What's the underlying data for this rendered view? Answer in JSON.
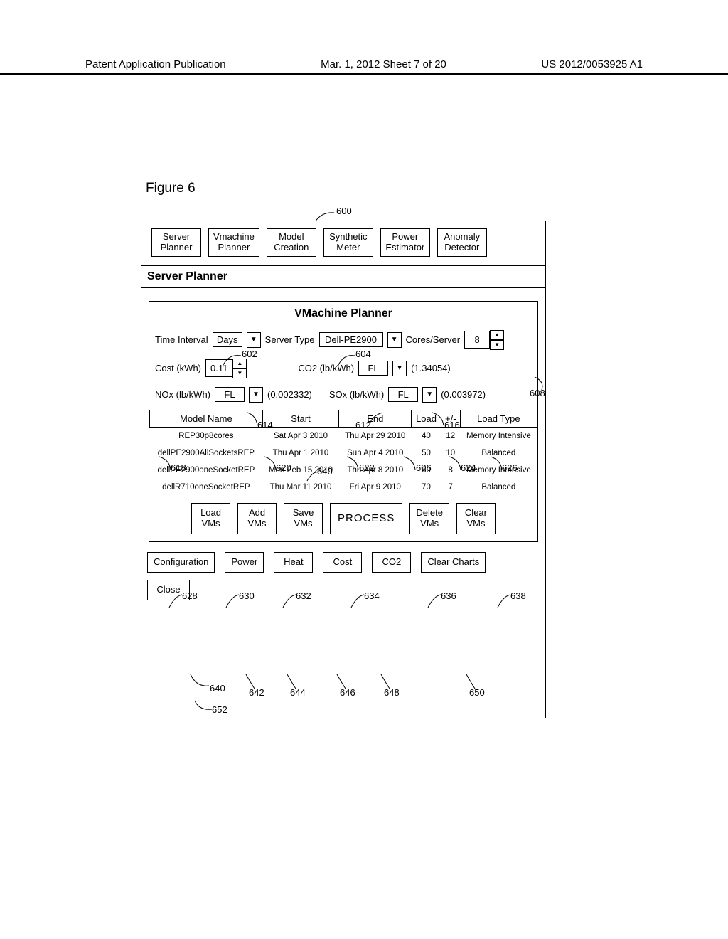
{
  "header": {
    "left": "Patent Application Publication",
    "center": "Mar. 1, 2012  Sheet 7 of 20",
    "right": "US 2012/0053925 A1"
  },
  "figure_label": "Figure 6",
  "panel_ref": "600",
  "tabs": [
    {
      "l1": "Server",
      "l2": "Planner"
    },
    {
      "l1": "Vmachine",
      "l2": "Planner"
    },
    {
      "l1": "Model",
      "l2": "Creation"
    },
    {
      "l1": "Synthetic",
      "l2": "Meter"
    },
    {
      "l1": "Power",
      "l2": "Estimator"
    },
    {
      "l1": "Anomaly",
      "l2": "Detector"
    }
  ],
  "section_title": "Server Planner",
  "inner_title": "VMachine Planner",
  "row1": {
    "time_interval_label": "Time Interval",
    "time_interval_value": "Days",
    "server_type_label": "Server Type",
    "server_type_value": "Dell-PE2900",
    "cores_label": "Cores/Server",
    "cores_value": "8"
  },
  "row2": {
    "cost_label": "Cost (kWh)",
    "cost_value": "0.11",
    "co2_label": "CO2 (lb/kWh)",
    "co2_sel": "FL",
    "co2_paren": "(1.34054)"
  },
  "row3": {
    "nox_label": "NOx (lb/kWh)",
    "nox_sel": "FL",
    "nox_paren": "(0.002332)",
    "sox_label": "SOx (lb/kWh)",
    "sox_sel": "FL",
    "sox_paren": "(0.003972)"
  },
  "table": {
    "headers": [
      "Model Name",
      "Start",
      "End",
      "Load",
      "+/-",
      "Load Type"
    ],
    "rows": [
      [
        "REP30p8cores",
        "Sat Apr 3 2010",
        "Thu Apr 29 2010",
        "40",
        "12",
        "Memory Intensive"
      ],
      [
        "dellPE2900AllSocketsREP",
        "Thu Apr 1 2010",
        "Sun Apr 4 2010",
        "50",
        "10",
        "Balanced"
      ],
      [
        "dellPE2900oneSocketREP",
        "Mon Feb 15 2010",
        "Thu Apr 8 2010",
        "60",
        "8",
        "Memory Intensive"
      ],
      [
        "dellR710oneSocketREP",
        "Thu Mar 11 2010",
        "Fri Apr 9 2010",
        "70",
        "7",
        "Balanced"
      ]
    ]
  },
  "vm_buttons": [
    {
      "l1": "Load",
      "l2": "VMs"
    },
    {
      "l1": "Add",
      "l2": "VMs"
    },
    {
      "l1": "Save",
      "l2": "VMs"
    },
    {
      "l1": "PROCESS",
      "l2": ""
    },
    {
      "l1": "Delete",
      "l2": "VMs"
    },
    {
      "l1": "Clear",
      "l2": "VMs"
    }
  ],
  "chart_buttons": [
    "Configuration",
    "Power",
    "Heat",
    "Cost",
    "CO2",
    "Clear Charts"
  ],
  "close_label": "Close",
  "callouts": {
    "c600": "600",
    "c602": "602",
    "c604": "604",
    "c608": "608",
    "c614": "614",
    "c612": "612",
    "c616": "616",
    "c618": "618",
    "c620": "620",
    "c640a": "640",
    "c622": "622",
    "c606": "606",
    "c624": "624",
    "c626": "626",
    "c628": "628",
    "c630": "630",
    "c632": "632",
    "c634": "634",
    "c636": "636",
    "c638": "638",
    "c640": "640",
    "c642": "642",
    "c644": "644",
    "c646": "646",
    "c648": "648",
    "c650": "650",
    "c652": "652"
  }
}
